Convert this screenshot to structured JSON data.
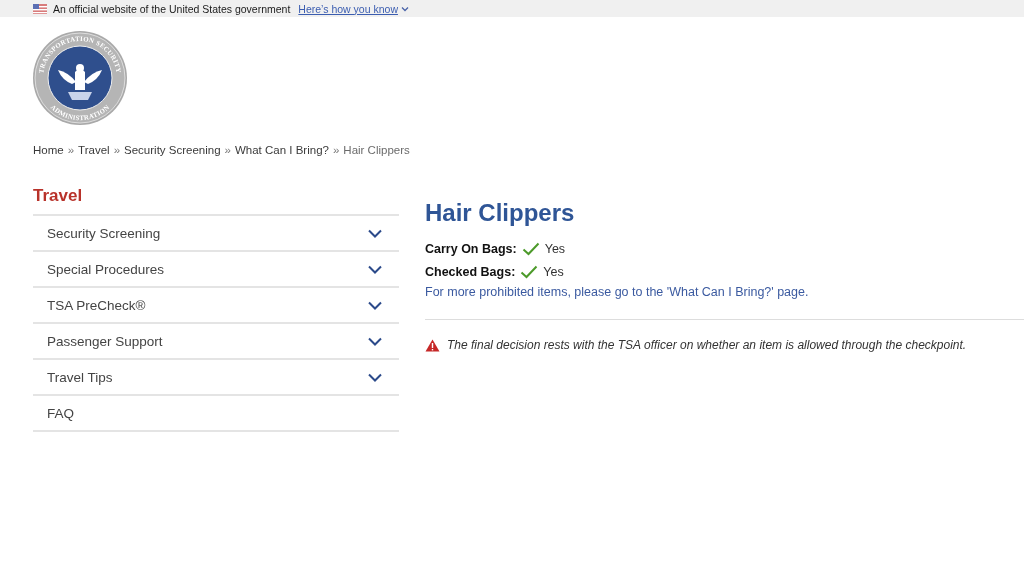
{
  "gov_banner": {
    "text": "An official website of the United States government",
    "link": "Here’s how you know"
  },
  "logo": {
    "top_text": "TRANSPORTATION SECURITY",
    "bottom_text": "ADMINISTRATION"
  },
  "breadcrumb": [
    {
      "label": "Home",
      "current": false
    },
    {
      "separator": "»",
      "label": "Travel",
      "current": false
    },
    {
      "separator": "»",
      "label": "Security Screening",
      "current": false
    },
    {
      "separator": "»",
      "label": "What Can I Bring?",
      "current": false
    },
    {
      "separator": "»",
      "label": "Hair Clippers",
      "current": true
    }
  ],
  "sidebar": {
    "title": "Travel",
    "items": [
      {
        "label": "Security Screening",
        "kind": "menu"
      },
      {
        "label": "Special Procedures",
        "kind": "menu"
      },
      {
        "label": "TSA PreCheck®",
        "kind": "menu"
      },
      {
        "label": "Passenger Support",
        "kind": "menu"
      },
      {
        "label": "Travel Tips",
        "kind": "menu"
      },
      {
        "label": "FAQ",
        "kind": "link"
      }
    ]
  },
  "main": {
    "title": "Hair Clippers",
    "rules": [
      {
        "label": "Carry On Bags:",
        "allowed": true,
        "value": "Yes"
      },
      {
        "label": "Checked Bags:",
        "allowed": true,
        "value": "Yes"
      }
    ],
    "more_link": "For more prohibited items, please go to the 'What Can I Bring?' page.",
    "notice": "The final decision rests with the TSA officer on whether an item is allowed through the checkpoint."
  }
}
